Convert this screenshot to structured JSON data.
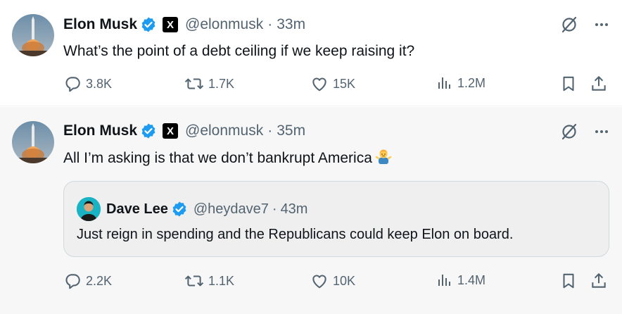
{
  "colors": {
    "verified": "#1d9bf0",
    "muted": "#536471",
    "text": "#0f1419",
    "alt_background": "#f7f7f7",
    "quote_background": "#efefef"
  },
  "tweets": [
    {
      "author": {
        "name": "Elon Musk",
        "handle": "@elonmusk",
        "verified": true,
        "affiliate_badge": "X"
      },
      "separator": "·",
      "time": "33m",
      "text": "What’s the point of a debt ceiling if we keep raising it?",
      "stats": {
        "replies": "3.8K",
        "retweets": "1.7K",
        "likes": "15K",
        "views": "1.2M"
      }
    },
    {
      "author": {
        "name": "Elon Musk",
        "handle": "@elonmusk",
        "verified": true,
        "affiliate_badge": "X"
      },
      "separator": "·",
      "time": "35m",
      "text": "All I’m asking is that we don’t bankrupt America",
      "emoji": "person-shrugging",
      "quoted": {
        "author": {
          "name": "Dave Lee",
          "handle": "@heydave7",
          "verified": true
        },
        "separator": "·",
        "time": "43m",
        "text": "Just reign in spending and the Republicans could keep Elon on board."
      },
      "stats": {
        "replies": "2.2K",
        "retweets": "1.1K",
        "likes": "10K",
        "views": "1.4M"
      }
    }
  ],
  "icons": {
    "grok": "grok-icon",
    "more": "more-icon",
    "reply": "reply-icon",
    "retweet": "retweet-icon",
    "like": "heart-icon",
    "views": "views-icon",
    "bookmark": "bookmark-icon",
    "share": "share-icon"
  }
}
